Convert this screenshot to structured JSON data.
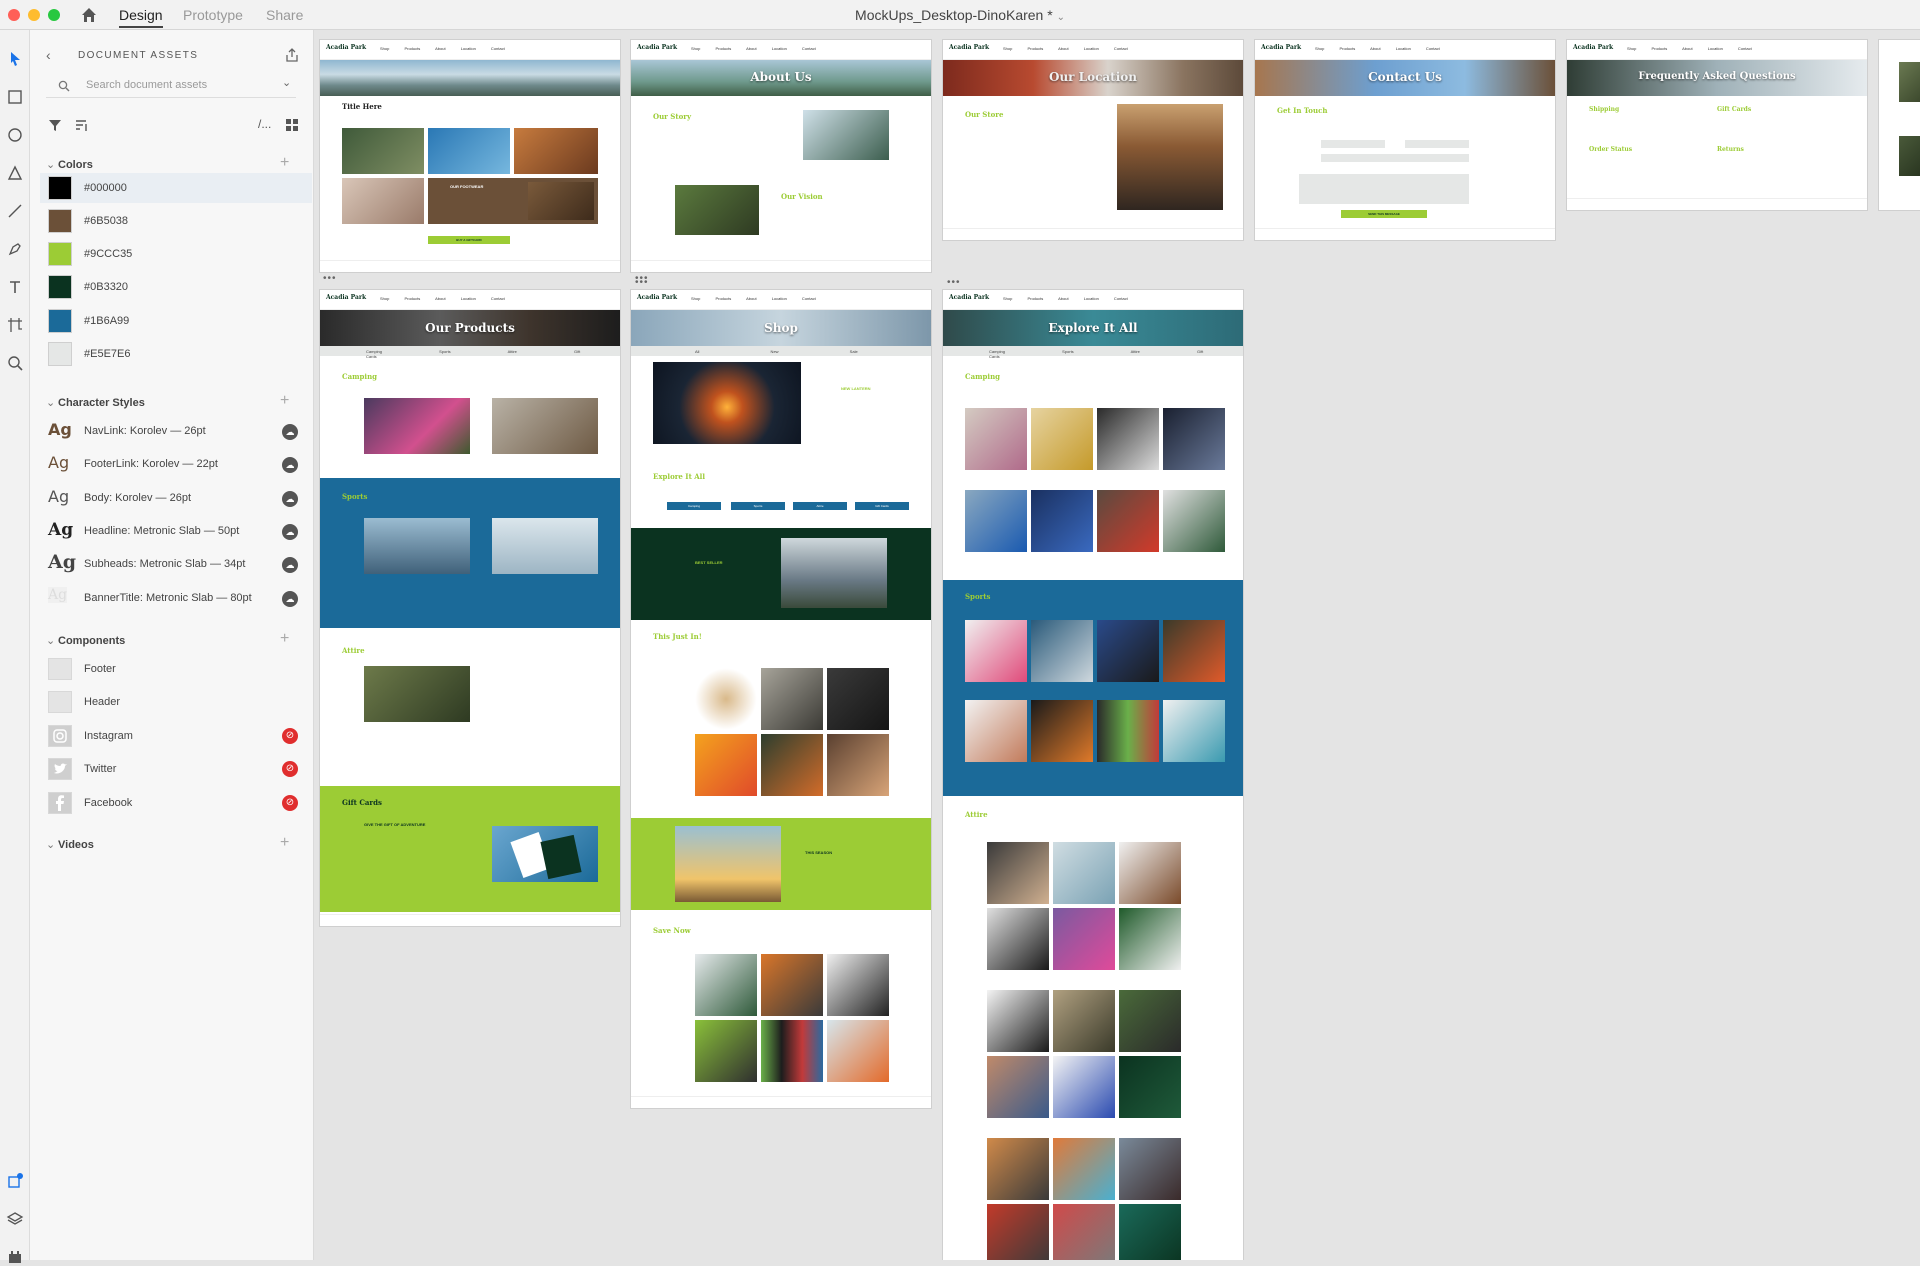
{
  "app": {
    "tabs": {
      "design": "Design",
      "prototype": "Prototype",
      "share": "Share"
    },
    "document_title": "MockUps_Desktop-DinoKaren *"
  },
  "assets": {
    "title": "DOCUMENT ASSETS",
    "search_placeholder": "Search document assets",
    "colors_header": "Colors",
    "colors": [
      {
        "label": "#000000",
        "hex": "#000000"
      },
      {
        "label": "#6B5038",
        "hex": "#6B5038"
      },
      {
        "label": "#9CCC35",
        "hex": "#9CCC35"
      },
      {
        "label": "#0B3320",
        "hex": "#0B3320"
      },
      {
        "label": "#1B6A99",
        "hex": "#1B6A99"
      },
      {
        "label": "#E5E7E6",
        "hex": "#E5E7E6"
      }
    ],
    "char_styles_header": "Character Styles",
    "char_styles": [
      {
        "label": "NavLink: Korolev — 26pt"
      },
      {
        "label": "FooterLink: Korolev — 22pt"
      },
      {
        "label": "Body: Korolev — 26pt"
      },
      {
        "label": "Headline: Metronic Slab — 50pt"
      },
      {
        "label": "Subheads: Metronic Slab — 34pt"
      },
      {
        "label": "BannerTitle: Metronic Slab — 80pt"
      }
    ],
    "ag_glyph": "Ag",
    "components_header": "Components",
    "components": [
      {
        "label": "Footer",
        "icon": "footer-thumb"
      },
      {
        "label": "Header",
        "icon": "header-thumb"
      },
      {
        "label": "Instagram",
        "icon": "instagram-icon"
      },
      {
        "label": "Twitter",
        "icon": "twitter-icon"
      },
      {
        "label": "Facebook",
        "icon": "facebook-icon"
      }
    ],
    "videos_header": "Videos"
  },
  "artboards": {
    "home": {
      "logo": "Acadia Park",
      "nav": "Shop Products About Location Contact",
      "title": "Title Here",
      "section": "OUR FOOTWEAR",
      "button": "BUY A GIFTCARD"
    },
    "about": {
      "logo": "Acadia Park",
      "nav": "Shop Products About Location Contact",
      "banner": "About Us",
      "h1": "Our Story",
      "h2": "Our Vision"
    },
    "location": {
      "logo": "Acadia Park",
      "nav": "Shop Products About Location Contact",
      "banner": "Our Location",
      "h1": "Our Store"
    },
    "contact": {
      "logo": "Acadia Park",
      "nav": "Shop Products About Location Contact",
      "banner": "Contact Us",
      "h1": "Get In Touch",
      "button": "SEND THIS MESSAGE"
    },
    "faq": {
      "logo": "Acadia Park",
      "nav": "Shop Products About Location Contact",
      "banner": "Frequently Asked Questions",
      "items": [
        "Shipping",
        "Gift Cards",
        "Order Status",
        "Returns"
      ]
    },
    "products": {
      "logo": "Acadia Park",
      "nav": "Shop Products About Location Contact",
      "banner": "Our Products",
      "sub": "Camping Sports Attire Gift Cards",
      "h1": "Camping",
      "h2": "Sports",
      "h3": "Attire",
      "h4": "Gift Cards",
      "gift": "GIVE THE GIFT OF ADVENTURE"
    },
    "shop": {
      "logo": "Acadia Park",
      "nav": "Shop Products About Location Contact",
      "banner": "Shop",
      "sub": "All New Sale",
      "new_label": "NEW LANTERN",
      "h1": "Explore It All",
      "cats": [
        "Camping",
        "Sports",
        "Attire",
        "Gift Cards"
      ],
      "best": "BEST SELLER",
      "h2": "This Just In!",
      "season": "THIS SEASON",
      "h3": "Save Now"
    },
    "explore": {
      "logo": "Acadia Park",
      "nav": "Shop Products About Location Contact",
      "banner": "Explore It All",
      "sub": "Camping Sports Attire Gift Cards",
      "h1": "Camping",
      "h2": "Sports",
      "h3": "Attire"
    }
  }
}
